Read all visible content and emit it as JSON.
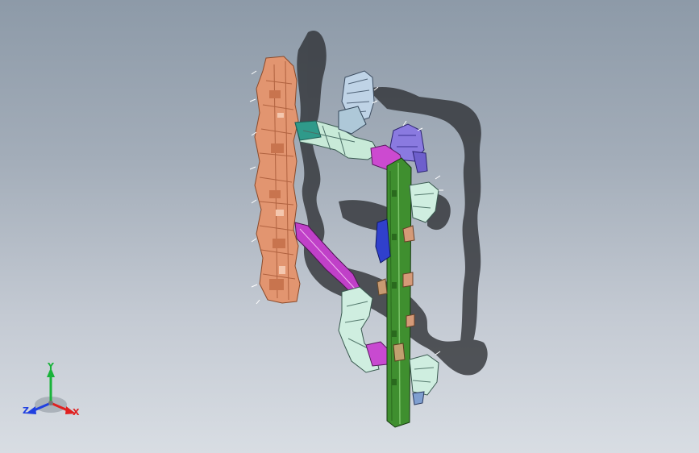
{
  "view": {
    "background_top": "#8d9aa8",
    "background_bottom": "#d8dde3"
  },
  "triad": {
    "y_label": "Y",
    "x_label": "X",
    "z_label": "Z",
    "y_color": "#19b33a",
    "x_color": "#e02020",
    "z_color": "#2040e0"
  },
  "model": {
    "parts": [
      {
        "name": "orange-bracket",
        "color": "#e0956a"
      },
      {
        "name": "green-rail",
        "color": "#3f8f2f"
      },
      {
        "name": "magenta-link",
        "color": "#c24cc8"
      },
      {
        "name": "pale-cyan-arms",
        "color": "#c6e8d8"
      },
      {
        "name": "blue-block",
        "color": "#2f3fc8"
      }
    ]
  }
}
